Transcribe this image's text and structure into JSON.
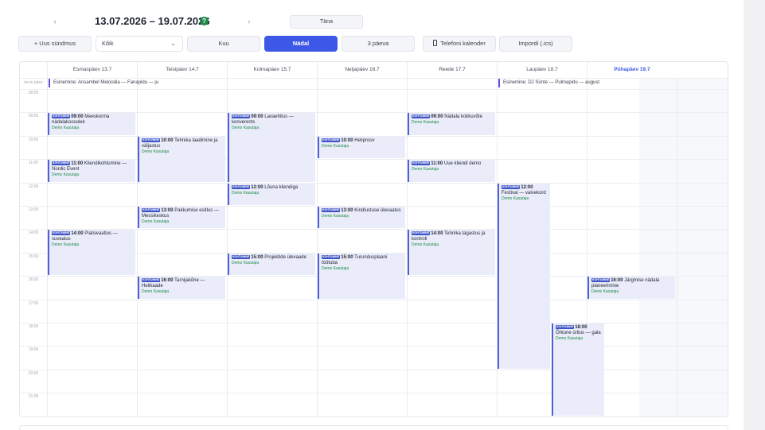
{
  "nav": {
    "prev_icon": "‹",
    "next_icon": "›",
    "range_title": "13.07.2026 – 19.07.2026",
    "help_icon": "?",
    "today_label": "Täna"
  },
  "toolbar": {
    "new_event_label": "+ Uus sündmus",
    "filter_value": "Kõik",
    "view_month": "Kuu",
    "view_week": "Nädal",
    "view_3days": "3 päeva",
    "phone_calendar": "Telefoni kalender",
    "import_ics": "Impordi (.ics)"
  },
  "days": [
    {
      "label": "Esmaspäev 13.7"
    },
    {
      "label": "Teisipäev 14.7"
    },
    {
      "label": "Kolmapäev 15.7"
    },
    {
      "label": "Neljapäev 16.7"
    },
    {
      "label": "Reede 17.7"
    },
    {
      "label": "Laupäev 18.7"
    },
    {
      "label": "Pühapäev 19.7"
    }
  ],
  "allday_label": "terve päev",
  "hours": [
    "08:00",
    "09:00",
    "10:00",
    "11:00",
    "12:00",
    "13:00",
    "14:00",
    "15:00",
    "16:00",
    "17:00",
    "18:00",
    "19:00",
    "20:00",
    "21:00"
  ],
  "allday_events": [
    {
      "day": 0,
      "title": "Esinemine: Ansambel Meloodia — Fanapidu — juuli"
    },
    {
      "day": 5,
      "title": "Esinemine: DJ Sünte — Pulmapidu — august"
    }
  ],
  "events": [
    {
      "day": 0,
      "badge": "KOHTUMINE",
      "time": "09:00",
      "title": "Meeskonna nädalakoosolek",
      "owner": "Demo Kasutaja",
      "start": 9.0,
      "end": 10.0
    },
    {
      "day": 0,
      "badge": "KOHTUMINE",
      "time": "11:00",
      "title": "Kliendikohtumine — Nordic Event",
      "owner": "Demo Kasutaja",
      "start": 11.0,
      "end": 12.0
    },
    {
      "day": 0,
      "badge": "KOHTUMINE",
      "time": "14:00",
      "title": "Platsivaatlus — suvealus",
      "owner": "Demo Kasutaja",
      "start": 14.0,
      "end": 16.0
    },
    {
      "day": 1,
      "badge": "KOHTUMINE",
      "time": "10:00",
      "title": "Tehnika laadimine ja väljastus",
      "owner": "Demo Kasutaja",
      "start": 10.0,
      "end": 12.0
    },
    {
      "day": 1,
      "badge": "KOHTUMINE",
      "time": "13:00",
      "title": "Pakkumise esitlus — Messikeskus",
      "owner": "Demo Kasutaja",
      "start": 13.0,
      "end": 14.0
    },
    {
      "day": 1,
      "badge": "KOHTUMINE",
      "time": "16:00",
      "title": "Tarnijakõne — Helikaade",
      "owner": "Demo Kasutaja",
      "start": 16.0,
      "end": 17.0
    },
    {
      "day": 2,
      "badge": "KOHTUMINE",
      "time": "09:00",
      "title": "Lavaehitus — konverents",
      "owner": "Demo Kasutaja",
      "start": 9.0,
      "end": 12.0
    },
    {
      "day": 2,
      "badge": "KOHTUMINE",
      "time": "12:00",
      "title": "Lõuna kliendiga",
      "owner": "Demo Kasutaja",
      "start": 12.0,
      "end": 13.0
    },
    {
      "day": 2,
      "badge": "KOHTUMINE",
      "time": "15:00",
      "title": "Projektide ülevaade",
      "owner": "Demo Kasutaja",
      "start": 15.0,
      "end": 16.0
    },
    {
      "day": 3,
      "badge": "KOHTUMINE",
      "time": "10:00",
      "title": "Heliproov",
      "owner": "Demo Kasutaja",
      "start": 10.0,
      "end": 11.0
    },
    {
      "day": 3,
      "badge": "KOHTUMINE",
      "time": "13:00",
      "title": "Kindlustuse ülevaatus",
      "owner": "Demo Kasutaja",
      "start": 13.0,
      "end": 14.0
    },
    {
      "day": 3,
      "badge": "KOHTUMINE",
      "time": "15:00",
      "title": "Turundusplaani töötuba",
      "owner": "Demo Kasutaja",
      "start": 15.0,
      "end": 17.0
    },
    {
      "day": 4,
      "badge": "KOHTUMINE",
      "time": "09:00",
      "title": "Nädala kokkuvõte",
      "owner": "Demo Kasutaja",
      "start": 9.0,
      "end": 10.0
    },
    {
      "day": 4,
      "badge": "KOHTUMINE",
      "time": "11:00",
      "title": "Uue kliendi demo",
      "owner": "Demo Kasutaja",
      "start": 11.0,
      "end": 12.0
    },
    {
      "day": 4,
      "badge": "KOHTUMINE",
      "time": "14:00",
      "title": "Tehnika tagastus ja kontroll",
      "owner": "Demo Kasutaja",
      "start": 14.0,
      "end": 16.0
    },
    {
      "day": 5,
      "badge": "KOHTUMINE",
      "time": "12:00",
      "title": "Festival — valvekord",
      "owner": "Demo Kasutaja",
      "start": 12.0,
      "end": 20.0,
      "lane": 0
    },
    {
      "day": 5,
      "badge": "KOHTUMINE",
      "time": "18:00",
      "title": "Õhtune üritus — gala",
      "owner": "Demo Kasutaja",
      "start": 18.0,
      "end": 22.0,
      "lane": 1
    },
    {
      "day": 6,
      "badge": "KOHTUMINE",
      "time": "16:00",
      "title": "Järgmise nädala planeerimine",
      "owner": "Demo Kasutaja",
      "start": 16.0,
      "end": 17.0
    }
  ],
  "colors": {
    "accent": "#3d57e6",
    "event_bg": "#eaedf9",
    "owner": "#1e8a4a"
  }
}
